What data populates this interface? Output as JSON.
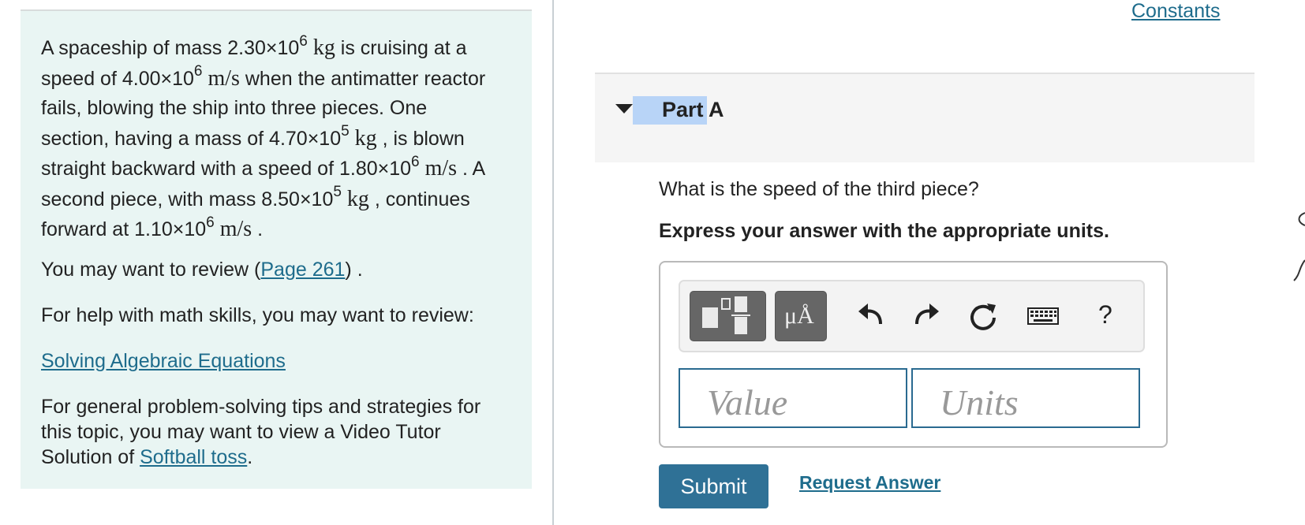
{
  "problem": {
    "t1": "A spaceship of mass 2.30×10",
    "e1": "6",
    "u1": "kg",
    "t2": " is cruising at a speed of 4.00×10",
    "e2": "6",
    "u2": "m/s",
    "t3": " when the antimatter reactor fails, blowing the ship into three pieces. One section, having a mass of 4.70×10",
    "e3": "5",
    "u3": "kg",
    "t4": " , is blown straight backward with a speed of 1.80×10",
    "e4": "6",
    "u4": "m/s",
    "t5": " . A second piece, with mass 8.50×10",
    "e5": "5",
    "u5": "kg",
    "t6": " , continues forward at 1.10×10",
    "e6": "6",
    "u6": "m/s",
    "t7": " ."
  },
  "review": {
    "prefix": "You may want to review (",
    "link": "Page 261",
    "suffix": ") ."
  },
  "math_help": {
    "text": "For help with math skills, you may want to review:",
    "link": "Solving Algebraic Equations"
  },
  "tips": {
    "text": "For general problem-solving tips and strategies for this topic, you may want to view a Video Tutor Solution of ",
    "link": "Softball toss",
    "suffix": "."
  },
  "constants_link": "Constants",
  "part": {
    "title": "Part A"
  },
  "question": "What is the speed of the third piece?",
  "instruction": "Express your answer with the appropriate units.",
  "toolbar": {
    "units_label": "μÅ",
    "help_label": "?",
    "icons": [
      "templates-icon",
      "units-icon",
      "undo-icon",
      "redo-icon",
      "reset-icon",
      "keyboard-icon",
      "help-icon"
    ]
  },
  "inputs": {
    "value_placeholder": "Value",
    "units_placeholder": "Units"
  },
  "buttons": {
    "submit": "Submit",
    "request_answer": "Request Answer"
  },
  "colors": {
    "left_panel_bg": "#e9f5f3",
    "link": "#1e6c8c",
    "submit_bg": "#2f7196",
    "highlight": "#b8d4f7"
  }
}
